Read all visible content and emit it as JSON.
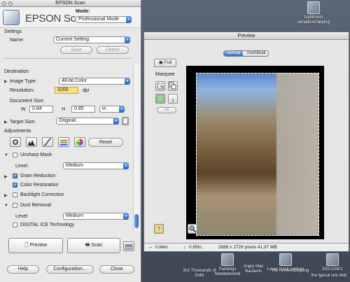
{
  "desktop": {
    "icons": [
      "Lightroom serialtextClipping",
      "Paintings Neededworldr",
      "Angry Mac Bastards",
      "Layer mask capture",
      "DSC10001",
      "3x3 Thousands of Dolls",
      "the newtextClipping",
      "the typical last step"
    ]
  },
  "main_window": {
    "title": "EPSON Scan",
    "brand": "EPSON Scan",
    "mode_label": "Mode:",
    "mode_value": "Professional Mode",
    "settings": {
      "heading": "Settings",
      "name_label": "Name:",
      "name_value": "Current Setting",
      "save_label": "Save",
      "delete_label": "Delete"
    },
    "destination": {
      "heading": "Destination",
      "image_type_label": "Image Type:",
      "image_type_value": "48-bit Color",
      "resolution_label": "Resolution:",
      "resolution_value": "3200",
      "resolution_unit": "dpi",
      "document_size_label": "Document Size:",
      "w_label": "W",
      "w_value": "0.84",
      "h_label": "H",
      "h_value": "0.85",
      "size_unit": "in.",
      "target_size_label": "Target Size:",
      "target_size_value": "Original"
    },
    "adjustments": {
      "heading": "Adjustments",
      "reset_label": "Reset",
      "unsharp_mask_label": "Unsharp Mask",
      "unsharp_level_label": "Level:",
      "unsharp_level_value": "Medium",
      "grain_reduction_label": "Grain Reduction",
      "color_restoration_label": "Color Restoration",
      "backlight_correction_label": "Backlight Correction",
      "dust_removal_label": "Dust Removal",
      "dust_level_label": "Level:",
      "dust_level_value": "Medium",
      "digital_ice_label": "DIGITAL ICE Technology"
    },
    "preview_label": "Preview",
    "scan_label": "Scan",
    "help_label": "Help",
    "configuration_label": "Configuration...",
    "close_label": "Close"
  },
  "preview_window": {
    "title": "Preview",
    "tab_normal": "Normal",
    "tab_thumbnail": "Thumbnail",
    "full_label": "Full",
    "marquee_label": "Marquee",
    "marquee_count": "1",
    "all_label": "All",
    "status_width": "0.84in.",
    "status_height": "0.85in.",
    "status_pixels": "2688 x 2729 pixels 41.97 MB"
  },
  "colors": {
    "accent": "#2c66c6",
    "resolution_highlight": "#f6e27a"
  }
}
